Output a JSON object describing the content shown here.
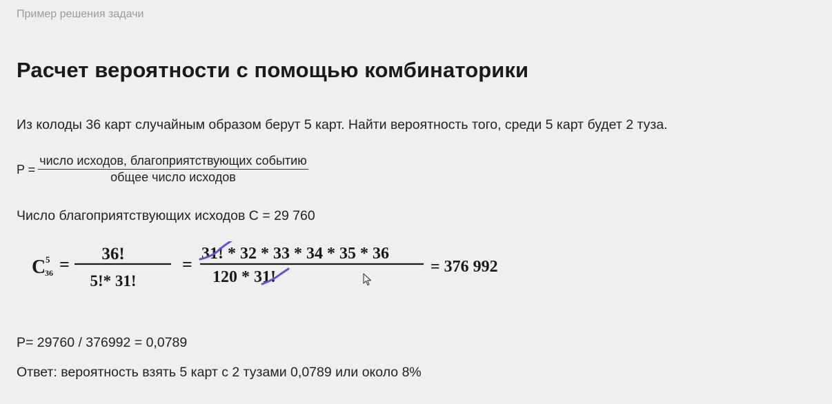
{
  "breadcrumb": "Пример решения задачи",
  "title": "Расчет вероятности с помощью комбинаторики",
  "problem": "Из колоды 36 карт случайным образом берут 5 карт. Найти вероятность того, среди 5 карт будет 2 туза.",
  "probability_formula": {
    "label": "P =",
    "numerator": "число исходов, благоприятствующих событию",
    "denominator": "общее число исходов"
  },
  "favorable": "Число благоприятствующих исходов C = 29 760",
  "combination": {
    "symbol": "C",
    "k": "5",
    "n": "36",
    "frac1_num": "36!",
    "frac1_den": "5!* 31!",
    "frac2_num_struck": "31!",
    "frac2_num_rest": " * 32 * 33 * 34 * 35 * 36",
    "frac2_den_prefix": "120 * ",
    "frac2_den_struck": "31!",
    "result": "= 376 992"
  },
  "result_line": "P= 29760 / 376992 = 0,0789",
  "answer_line": "Ответ: вероятность взять 5 карт с 2 тузами  0,0789  или около 8%",
  "colors": {
    "background": "#efefef",
    "strike": "#6a4fd0",
    "muted": "#9a9a9a"
  }
}
